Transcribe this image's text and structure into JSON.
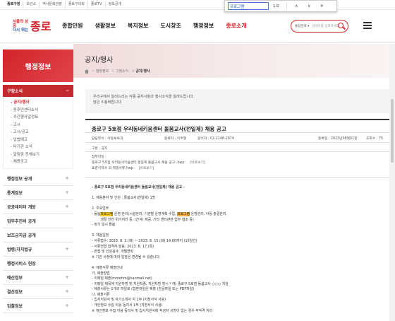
{
  "util_links": [
    "종로구청",
    "보건소",
    "역사문화관광",
    "종로구의회",
    "종로TV",
    "정보공개"
  ],
  "find_bar": {
    "query": "프로그램",
    "count": "1/2",
    "prev": "∧",
    "next": "∨",
    "close": "✕"
  },
  "logo": {
    "slogan_line1": "서울의 상징",
    "slogan_line2": "다시 뛰는",
    "name": "종로"
  },
  "nav": [
    "종합민원",
    "생활정보",
    "복지정보",
    "도시창조",
    "행정정보",
    "종로소개"
  ],
  "header_search": {
    "scope": "통합검색",
    "placeholder": "검색어를 입력하세요."
  },
  "sidebar": {
    "title": "행정정보",
    "group": {
      "label": "구정소식",
      "toggle": "−",
      "items": [
        {
          "label": "공지/행사",
          "active": true
        },
        {
          "label": "동주민센터소식"
        },
        {
          "label": "주간행사일정표"
        },
        {
          "label": "고시"
        },
        {
          "label": "고시/공고"
        },
        {
          "label": "입법예고"
        },
        {
          "label": "타기관 소식"
        },
        {
          "label": "알림판 전체보기"
        },
        {
          "label": "채용공고"
        }
      ]
    },
    "menu": [
      "행정정보 공개",
      "통계정보",
      "공공데이터 개방",
      "업무추진비 공개",
      "보조금지급 공개",
      "법령/자치법규",
      "행정서비스 헌장",
      "예산정보",
      "결산정보",
      "입찰정보"
    ],
    "plus": "+"
  },
  "page": {
    "title": "공지/행사",
    "breadcrumb": [
      "행정정보",
      "구정소식",
      "공지/행사"
    ],
    "intro_line1": "우리구에서 알려드리는 각종 공지사항과 행사소식을 알려드립니다.",
    "intro_line2": "많은 이용바랍니다."
  },
  "post": {
    "title": "종로구 5호점 우리동네키움센터 돌봄교사(전일제) 채용 공고",
    "author": "담당부서 : 아동보육과",
    "writer": "등록자 : 이주형",
    "phone": "문의처 : 02-2148-2974",
    "date": "등록일 : 2023년08월01일",
    "views": "조회수 : 75",
    "category": "구분 : 공지",
    "files_label": "첨부파일 :",
    "files": [
      {
        "name": "종로구 5호점 우리동네키움센터 종일제 돌봄교사 채용 공고-.hwp",
        "view": "[바로보기]"
      },
      {
        "name": "표준이력서 외 제출서류.hwp",
        "view": "[바로보기]"
      }
    ],
    "body": {
      "heading": "- 종로구 5호점 우리동네키움센터 돌봄교사(전일제) 채용 공고 -",
      "s1": "1. 채용분야 및 인원 : 돌봄교사(전일제) 1명",
      "s2": "2. 주요업무",
      "s2a_pre": "- 돌봄",
      "s2a_hl1": "프로그램",
      "s2a_mid": " 운영 관리(시설관리, 기관별 운영계획 수립, ",
      "s2a_hl2": "프로그램",
      "s2a_mid2": " 운영관리, 아동 출결관리, ",
      "s2a_hl3": "프로그램",
      "s2a_post": " 운영관리, 아동 출결관리,",
      "s2b": "        생활 안전 위기처리 등, (간식) 제공, 기타 센터관련 업무 협조 등)",
      "s2c": "- 정기 일시 돌봄",
      "s3": "3. 채용일정",
      "s3a": "- 서류접수: 2023. 8. 1.(화) ~ 2023. 8. 15.(화) 14:00까지 (15일간)",
      "s3b": "- 서류전형 합격자 발표: 2023. 8. 17.(목)",
      "s3c": "- 면접 및 인성검사: 개별연락",
      "s3d": "※ 기관 사정에 따라 일정은 변경될 수 있습니다.",
      "s4": "4. 제출서류 제출안내",
      "s4a": "가. 제출방법",
      "s4b": "- 이메일 제출(mmohm@hanmail.net)",
      "s4c": "- 이메일 제목에 지원자명 및 지원직종, 지원자명 명시 * 예: 종로구 5호점 돌봄교사 ○○○ 지원",
      "s4d": "- 제출서류는 1개의 파일로 (합본파일은 제출 (한글파일 또는 PDF파일)",
      "s4e": "나. 제출서류",
      "s4f": "- 입사지원서 및 자기소개서 각 1부 (지정서식 사용)",
      "s4g": "- 개인정보 수집 이용 동의서 1부 (지정서식 사용)",
      "s4h": "※ 개인정보 수집 이용 동의서 및 입사지원서에 작성자 서명이 없는 경우 부적격 처리"
    }
  }
}
